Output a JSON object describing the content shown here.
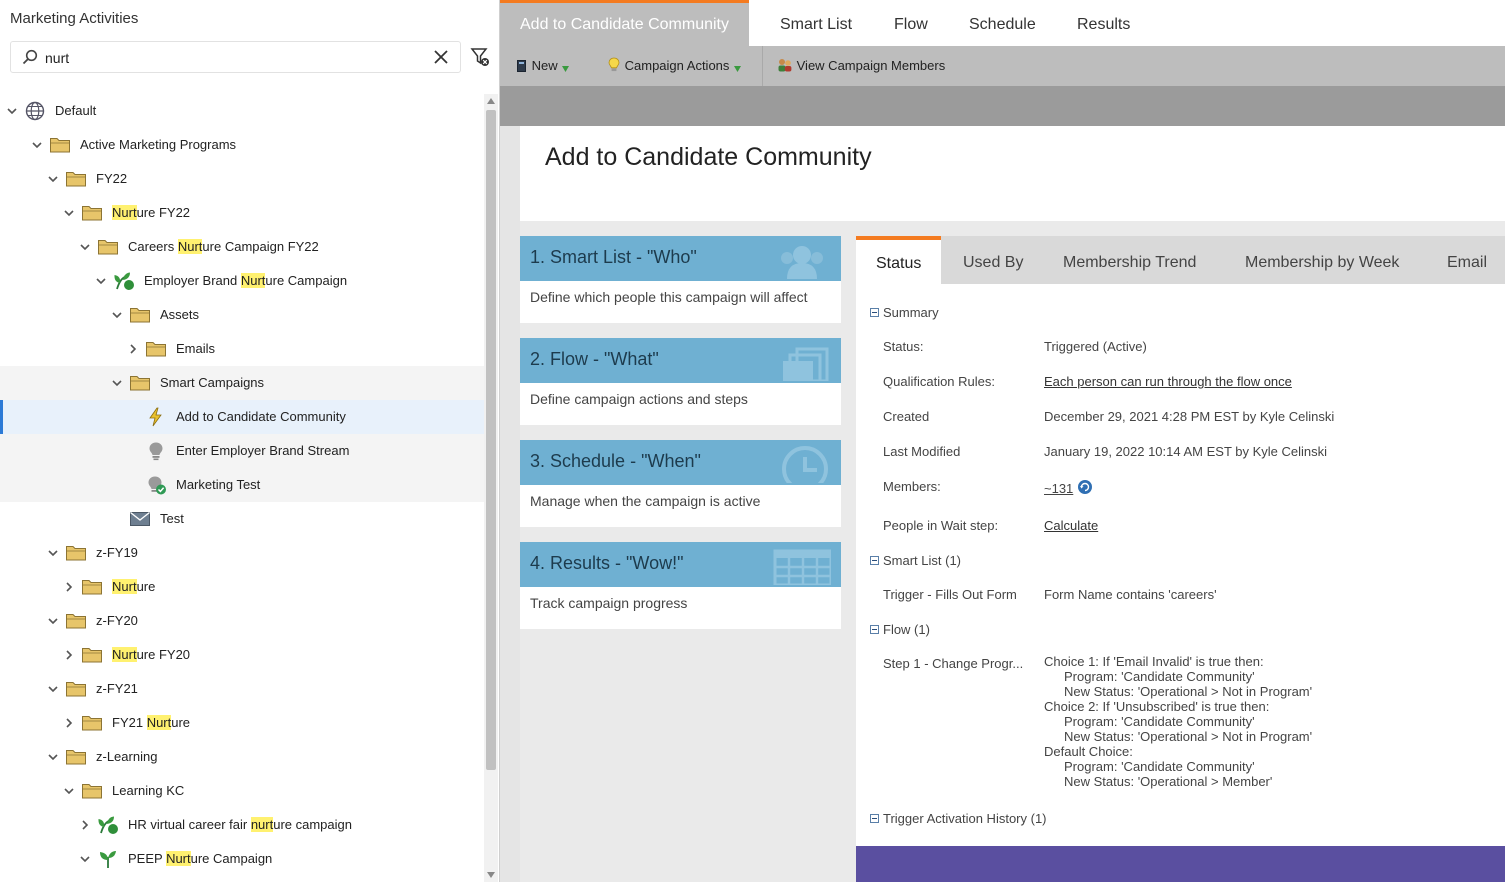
{
  "left_panel": {
    "title": "Marketing Activities",
    "search": {
      "value": "nurt",
      "placeholder": ""
    }
  },
  "tree": [
    {
      "id": "default",
      "label_pre": "Default",
      "label_hl": "",
      "label_post": "",
      "icon": "globe-icon",
      "expanded": true
    },
    {
      "id": "amp",
      "label_pre": "Active Marketing Programs",
      "label_hl": "",
      "label_post": "",
      "icon": "folder-icon",
      "expanded": true
    },
    {
      "id": "fy22",
      "label_pre": "FY22",
      "label_hl": "",
      "label_post": "",
      "icon": "folder-icon",
      "expanded": true
    },
    {
      "id": "nfy22",
      "label_pre": "",
      "label_hl": "Nurt",
      "label_post": "ure FY22",
      "icon": "folder-icon",
      "expanded": true
    },
    {
      "id": "cnc",
      "label_pre": "Careers ",
      "label_hl": "Nurt",
      "label_post": "ure Campaign FY22",
      "icon": "folder-icon",
      "expanded": true
    },
    {
      "id": "ebnc",
      "label_pre": "Employer Brand ",
      "label_hl": "Nurt",
      "label_post": "ure Campaign",
      "icon": "program-icon",
      "expanded": true
    },
    {
      "id": "assets",
      "label_pre": "Assets",
      "label_hl": "",
      "label_post": "",
      "icon": "folder-icon",
      "expanded": true
    },
    {
      "id": "emails",
      "label_pre": "Emails",
      "label_hl": "",
      "label_post": "",
      "icon": "folder-icon",
      "expanded": false
    },
    {
      "id": "smartc",
      "label_pre": "Smart Campaigns",
      "label_hl": "",
      "label_post": "",
      "icon": "folder-icon",
      "expanded": true
    },
    {
      "id": "atcc",
      "label_pre": "Add to Candidate Community",
      "label_hl": "",
      "label_post": "",
      "icon": "trigger-campaign-icon"
    },
    {
      "id": "eebs",
      "label_pre": "Enter Employer Brand Stream",
      "label_hl": "",
      "label_post": "",
      "icon": "batch-campaign-icon"
    },
    {
      "id": "mt",
      "label_pre": "Marketing Test",
      "label_hl": "",
      "label_post": "",
      "icon": "active-batch-campaign-icon"
    },
    {
      "id": "test",
      "label_pre": "Test",
      "label_hl": "",
      "label_post": "",
      "icon": "email-icon"
    },
    {
      "id": "zfy19",
      "label_pre": "z-FY19",
      "label_hl": "",
      "label_post": "",
      "icon": "folder-icon",
      "expanded": true
    },
    {
      "id": "n19",
      "label_pre": "",
      "label_hl": "Nurt",
      "label_post": "ure",
      "icon": "folder-icon",
      "expanded": false
    },
    {
      "id": "zfy20",
      "label_pre": "z-FY20",
      "label_hl": "",
      "label_post": "",
      "icon": "folder-icon",
      "expanded": true
    },
    {
      "id": "nfy20",
      "label_pre": "",
      "label_hl": "Nurt",
      "label_post": "ure FY20",
      "icon": "folder-icon",
      "expanded": false
    },
    {
      "id": "zfy21",
      "label_pre": "z-FY21",
      "label_hl": "",
      "label_post": "",
      "icon": "folder-icon",
      "expanded": true
    },
    {
      "id": "fy21n",
      "label_pre": "FY21 ",
      "label_hl": "Nurt",
      "label_post": "ure",
      "icon": "folder-icon",
      "expanded": false
    },
    {
      "id": "zl",
      "label_pre": "z-Learning",
      "label_hl": "",
      "label_post": "",
      "icon": "folder-icon",
      "expanded": true
    },
    {
      "id": "lkc",
      "label_pre": "Learning KC",
      "label_hl": "",
      "label_post": "",
      "icon": "folder-icon",
      "expanded": true
    },
    {
      "id": "hrv",
      "label_pre": "HR virtual career fair ",
      "label_hl": "nurt",
      "label_post": "ure campaign",
      "icon": "program-icon",
      "expanded": false
    },
    {
      "id": "peep",
      "label_pre": "PEEP ",
      "label_hl": "Nurt",
      "label_post": "ure Campaign",
      "icon": "engagement-program-icon",
      "expanded": true
    }
  ],
  "tabs": [
    "Add to Candidate Community",
    "Smart List",
    "Flow",
    "Schedule",
    "Results"
  ],
  "toolbar": {
    "new": "New",
    "campaign_actions": "Campaign Actions",
    "view_members": "View Campaign Members"
  },
  "page_title": "Add to Candidate Community",
  "steps": [
    {
      "title": "1. Smart List - \"Who\"",
      "desc": "Define which people this campaign will affect",
      "icon": "people-icon"
    },
    {
      "title": "2. Flow - \"What\"",
      "desc": "Define campaign actions and steps",
      "icon": "stack-icon"
    },
    {
      "title": "3. Schedule - \"When\"",
      "desc": "Manage when the campaign is active",
      "icon": "clock-icon"
    },
    {
      "title": "4. Results - \"Wow!\"",
      "desc": "Track campaign progress",
      "icon": "table-icon"
    }
  ],
  "detail_tabs": [
    "Status",
    "Used By",
    "Membership Trend",
    "Membership by Week",
    "Email"
  ],
  "summary": {
    "header": "Summary",
    "status_label": "Status:",
    "status_value": "Triggered (Active)",
    "qual_label": "Qualification Rules:",
    "qual_value": "Each person can run through the flow once",
    "created_label": "Created",
    "created_value": "December 29, 2021 4:28 PM EST by Kyle Celinski",
    "modified_label": "Last Modified",
    "modified_value": "January 19, 2022 10:14 AM EST by Kyle Celinski",
    "members_label": "Members:",
    "members_value": "~131",
    "wait_label": "People in Wait step:",
    "wait_value": "Calculate"
  },
  "smart_list": {
    "header": "Smart List (1)",
    "trigger_label": "Trigger - Fills Out Form",
    "trigger_value": "Form Name contains 'careers'"
  },
  "flow": {
    "header": "Flow (1)",
    "step_label": "Step 1 - Change Progr...",
    "lines": [
      "Choice 1: If 'Email Invalid' is true then:",
      "Program: 'Candidate Community'",
      "New Status: 'Operational > Not in Program'",
      "Choice 2: If 'Unsubscribed' is true then:",
      "Program: 'Candidate Community'",
      "New Status: 'Operational > Not in Program'",
      "Default Choice:",
      "Program: 'Candidate Community'",
      "New Status: 'Operational > Member'"
    ]
  },
  "trigger_history": {
    "header": "Trigger Activation History (1)"
  },
  "colors": {
    "accent": "#f47b20",
    "step_header": "#6fb0d2",
    "selection": "#e8f1fb",
    "highlight": "#fff170",
    "footer": "#5a4fa0"
  }
}
